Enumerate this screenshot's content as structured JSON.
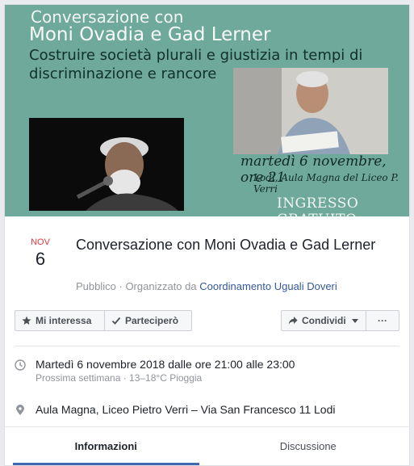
{
  "cover": {
    "line1": "Conversazione con",
    "line2": "Moni Ovadia e Gad Lerner",
    "line3": "Costruire società plurali e giustizia in tempi di",
    "line4": "discriminazione e rancore",
    "date_line": "martedì 6 novembre, ore 21",
    "place_line": "Lodi, Aula Magna del Liceo P. Verri",
    "free_entry": "INGRESSO GRATUITO",
    "colors": {
      "background": "#6fa99b"
    }
  },
  "event": {
    "month": "NOV",
    "day": "6",
    "title": "Conversazione con Moni Ovadia e Gad Lerner",
    "privacy": "Pubblico",
    "organized_prefix": "· Organizzato da",
    "organizer": "Coordinamento Uguali Doveri"
  },
  "actions": {
    "interest_label": "Mi interessa",
    "attend_label": "Parteciperò",
    "share_label": "Condividi",
    "more_label": "···"
  },
  "details": {
    "time_main": "Martedì 6 novembre 2018 dalle ore 21:00 alle 23:00",
    "time_sub": "Prossima settimana · 13–18°C Pioggia",
    "location": "Aula Magna, Liceo Pietro Verri – Via San Francesco 11   Lodi"
  },
  "tabs": [
    {
      "label": "Informazioni",
      "active": true
    },
    {
      "label": "Discussione",
      "active": false
    }
  ],
  "icons": [
    "star-icon",
    "check-icon",
    "share-arrow-icon",
    "more-icon",
    "clock-icon",
    "location-pin-icon"
  ]
}
